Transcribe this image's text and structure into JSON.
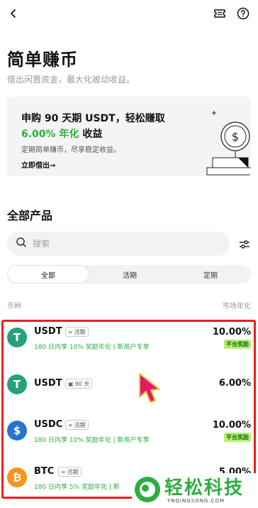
{
  "header": {
    "title": "简单赚币",
    "subtitle": "借出闲置资金，最大化被动收益。"
  },
  "promo": {
    "line1": "申购 90 天期 USDT，轻松赚取",
    "apy_highlight": "6.00% 年化",
    "line2_suffix": " 收益",
    "description": "定期简单赚币，尽享稳定收益。",
    "cta": "立即借出→"
  },
  "products": {
    "section_title": "全部产品",
    "search_placeholder": "搜索",
    "tabs": [
      "全部",
      "活期",
      "定期"
    ],
    "col_left": "币种",
    "col_right": "市场年化",
    "items": [
      {
        "coin": "USDT",
        "tag": "活期",
        "promo": "180 日内享 10% 奖励年化 | 新用户专享",
        "apy": "10.00%",
        "badge": "平台奖励",
        "color": "#26a17b",
        "symbol": "T"
      },
      {
        "coin": "USDT",
        "tag": "90 天",
        "promo": "",
        "apy": "6.00%",
        "badge": "",
        "color": "#26a17b",
        "symbol": "T"
      },
      {
        "coin": "USDC",
        "tag": "活期",
        "promo": "180 日内享 10% 奖励年化 | 新用户专享",
        "apy": "10.00%",
        "badge": "平台奖励",
        "color": "#2775ca",
        "symbol": "$"
      },
      {
        "coin": "BTC",
        "tag": "活期",
        "promo": "180 日内享 5% 奖励年化 | 新",
        "apy": "5.00%",
        "badge": "",
        "color": "#f7931a",
        "symbol": "₿"
      }
    ]
  },
  "watermark": {
    "text": "轻松科技",
    "sub": "YNQINGSONG.COM"
  },
  "colors": {
    "accent_green": "#2cae3f",
    "badge_bg": "#b8f06a",
    "highlight_red": "#e8201f",
    "cursor_pink": "#e0196b"
  }
}
